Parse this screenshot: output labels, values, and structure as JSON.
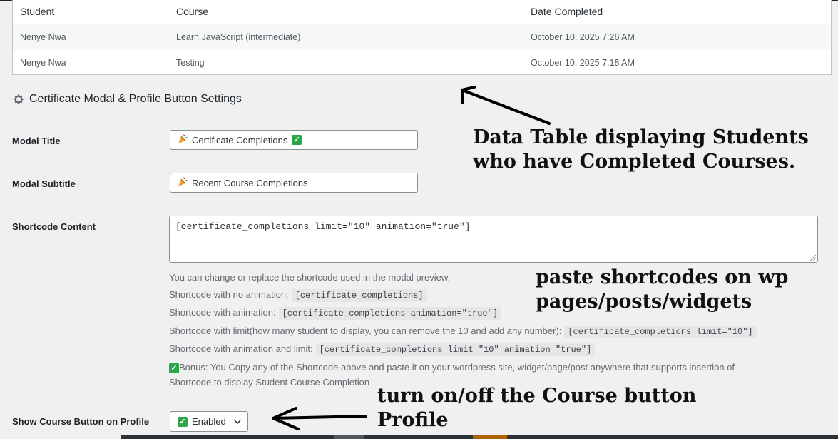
{
  "table": {
    "headers": [
      "Student",
      "Course",
      "Date Completed"
    ],
    "rows": [
      {
        "student": "Nenye Nwa",
        "course": "Learn JavaScript (intermediate)",
        "date": "October 10, 2025 7:26 AM"
      },
      {
        "student": "Nenye Nwa",
        "course": "Testing",
        "date": "October 10, 2025 7:18 AM"
      }
    ]
  },
  "settings": {
    "section_title": "Certificate Modal & Profile Button Settings",
    "modal_title_label": "Modal Title",
    "modal_title_value": "Certificate Completions",
    "modal_subtitle_label": "Modal Subtitle",
    "modal_subtitle_value": "Recent Course Completions",
    "shortcode_label": "Shortcode Content",
    "shortcode_value": "[certificate_completions limit=\"10\" animation=\"true\"]",
    "help": {
      "intro": "You can change or replace the shortcode used in the modal preview.",
      "no_anim_label": "Shortcode with no animation:",
      "no_anim_code": "[certificate_completions]",
      "anim_label": "Shortcode with animation:",
      "anim_code": "[certificate_completions animation=\"true\"]",
      "limit_label": "Shortcode with limit(how many student to display, you can remove the 10 and add any number):",
      "limit_code": "[certificate_completions limit=\"10\"]",
      "anim_limit_label": "Shortcode with animation and limit:",
      "anim_limit_code": "[certificate_completions limit=\"10\" animation=\"true\"]",
      "bonus_line1": "Bonus: You Copy any of the Shortcode above and paste it on your wordpress site, widget/page/post anywhere that supports insertion of",
      "bonus_line2": "Shortcode to display Student Course Completion"
    },
    "profile_button_label": "Show Course Button on Profile",
    "profile_button_value": "Enabled"
  },
  "annotations": {
    "table_note_line1": "Data Table displaying Students",
    "table_note_line2": "who have Completed Courses.",
    "shortcode_note_line1": "paste shortcodes on wp",
    "shortcode_note_line2": "pages/posts/widgets",
    "button_note_line1": "turn on/off the Course button",
    "button_note_line2": "Profile"
  },
  "colors": {
    "accent": "#2271b1",
    "check_green": "#2aa747"
  },
  "icons": {
    "section": "gear-icon",
    "field_prefix": "party-popper-icon",
    "status": "check-icon",
    "dropdown": "chevron-down-icon"
  }
}
